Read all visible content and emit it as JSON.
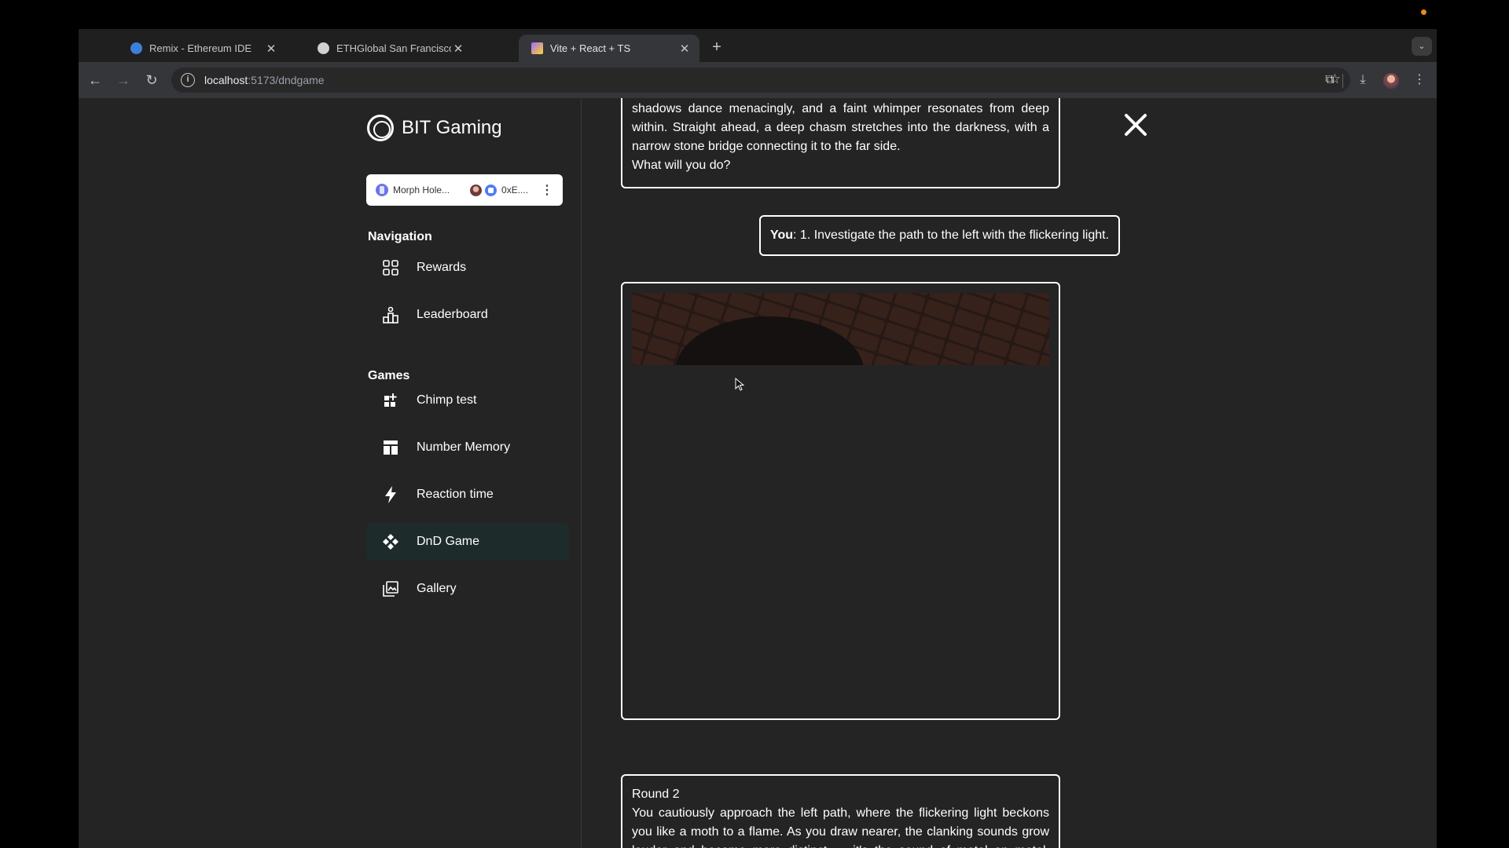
{
  "browser": {
    "tabs": [
      {
        "title": "Remix - Ethereum IDE",
        "favicon": "remix-icon",
        "favicon_color": "#3c7fd8"
      },
      {
        "title": "ETHGlobal San Francisco",
        "favicon": "ethglobal-icon",
        "favicon_color": "#d0d0d0"
      },
      {
        "title": "Vite + React + TS",
        "favicon": "vite-icon",
        "favicon_color": "#a26bfa",
        "active": true
      }
    ],
    "address": {
      "host": "localhost",
      "path": ":5173/dndgame"
    }
  },
  "sidebar": {
    "brand": "BIT Gaming",
    "wallet": {
      "chain": "Morph Hole...",
      "account": "0xE...."
    },
    "navigation_title": "Navigation",
    "navigation": [
      {
        "label": "Rewards",
        "icon": "grid-icon"
      },
      {
        "label": "Leaderboard",
        "icon": "podium-icon"
      }
    ],
    "games_title": "Games",
    "games": [
      {
        "label": "Chimp test",
        "icon": "grid-plus-icon"
      },
      {
        "label": "Number Memory",
        "icon": "layout-icon"
      },
      {
        "label": "Reaction time",
        "icon": "bolt-icon"
      },
      {
        "label": "DnD Game",
        "icon": "dpad-icon",
        "active": true
      },
      {
        "label": "Gallery",
        "icon": "gallery-icon"
      }
    ]
  },
  "chat": {
    "story1_lines": [
      "shadows dance menacingly, and a faint whimper resonates from deep within. Straight ahead, a deep chasm stretches into the darkness, with a narrow stone bridge connecting it to the far side.",
      "What will you do?"
    ],
    "user_prefix": "You",
    "user_message": ": 1. Investigate the path to the left with the flickering light.",
    "round_title": "Round 2",
    "round_text": "You cautiously approach the left path, where the flickering light beckons you like a moth to a flame. As you draw nearer, the clanking sounds grow louder and become more distinct — it's the sound of metal on metal. Stepping into the light, you find yourself in a large chamber filled with"
  }
}
